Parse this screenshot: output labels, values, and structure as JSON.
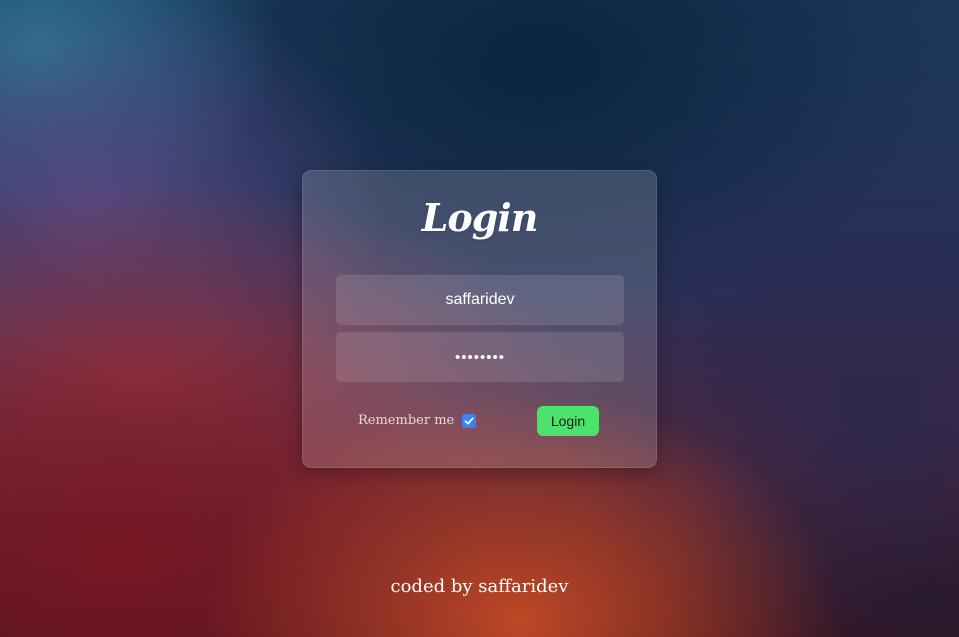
{
  "login_form": {
    "title": "Login",
    "username_value": "saffaridev",
    "password_value": "••••••••",
    "remember_label": "Remember me",
    "remember_checked": true,
    "submit_label": "Login"
  },
  "footer": {
    "credit": "coded by saffaridev"
  },
  "colors": {
    "submit_button": "#4be36c",
    "checkbox": "#3b82f6",
    "text": "#ffffff"
  },
  "icons": {
    "checkbox_mark": "checkmark-icon"
  }
}
